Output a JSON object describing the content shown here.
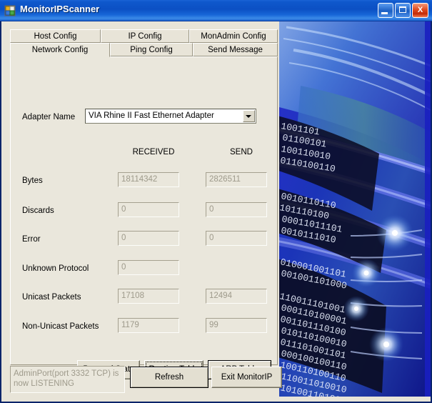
{
  "window": {
    "title": "MonitorIPScanner",
    "icon": "app-icon",
    "controls": {
      "minimize": "minimize-icon",
      "maximize": "maximize-icon",
      "close": "X"
    }
  },
  "tabs": {
    "top_row": [
      {
        "label": "Host Config",
        "selected": false
      },
      {
        "label": "IP Config",
        "selected": false
      },
      {
        "label": "MonAdmin Config",
        "selected": false
      }
    ],
    "bottom_row": [
      {
        "label": "Network Config",
        "selected": true
      },
      {
        "label": "Ping Config",
        "selected": false
      },
      {
        "label": "Send Message",
        "selected": false
      }
    ]
  },
  "form": {
    "adapter_label": "Adapter Name",
    "adapter_value": "VIA Rhine II Fast Ethernet Adapter",
    "adapter_arrow": "chevron-down-icon",
    "columns": {
      "received": "RECEIVED",
      "send": "SEND"
    },
    "rows": [
      {
        "label": "Bytes",
        "received": "18114342",
        "send": "2826511"
      },
      {
        "label": "Discards",
        "received": "0",
        "send": "0"
      },
      {
        "label": "Error",
        "received": "0",
        "send": "0"
      },
      {
        "label": "Unknown Protocol",
        "received": "0",
        "send": null
      },
      {
        "label": "Unicast Packets",
        "received": "17108",
        "send": "12494"
      },
      {
        "label": "Non-Unicast Packets",
        "received": "1179",
        "send": "99"
      }
    ],
    "buttons": {
      "protocol_stats": "Protocol Stats",
      "routing_table": "Routing Table",
      "arp_table": "ARP Table"
    }
  },
  "footer": {
    "status": "AdminPort(port 3332 TCP) is now LISTENING",
    "refresh": "Refresh",
    "exit": "Exit MonitorIP"
  },
  "colors": {
    "titlebar_blue": "#0b50c4",
    "close_red": "#c32c08",
    "panel_beige": "#EAE7DC",
    "disabled_text": "#9e9a8b",
    "deco_blue": "#1d21b4"
  }
}
